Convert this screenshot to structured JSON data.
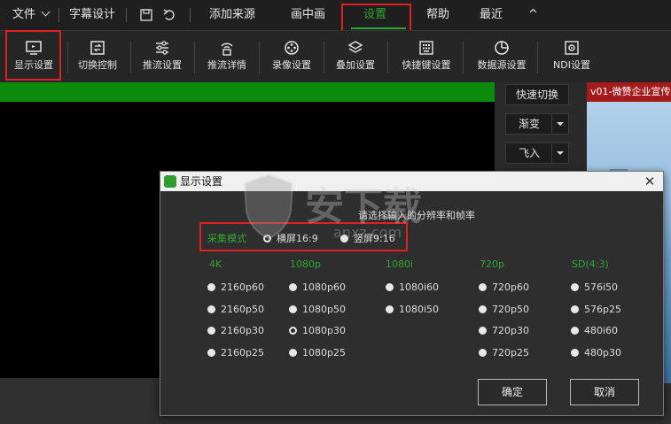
{
  "menubar": {
    "file": "文件",
    "subtitle_design": "字幕设计",
    "add_source": "添加来源",
    "pip": "画中画",
    "settings": "设置",
    "help": "帮助",
    "recent": "最近",
    "collapse_glyph": "^"
  },
  "toolbar": {
    "items": [
      {
        "label": "显示设置",
        "icon": "monitor-icon"
      },
      {
        "label": "切换控制",
        "icon": "switch-icon"
      },
      {
        "label": "推流设置",
        "icon": "sliders-icon"
      },
      {
        "label": "推流详情",
        "icon": "broadcast-icon"
      },
      {
        "label": "录像设置",
        "icon": "record-icon"
      },
      {
        "label": "叠加设置",
        "icon": "layers-icon"
      },
      {
        "label": "快捷键设置",
        "icon": "keyboard-icon"
      },
      {
        "label": "数据源设置",
        "icon": "pie-icon"
      },
      {
        "label": "NDI设置",
        "icon": "ndi-icon"
      }
    ]
  },
  "sidepanel": {
    "quick_switch": "快速切换",
    "transition1": "渐变",
    "transition2": "飞入"
  },
  "rightpane": {
    "title": "v01-微赞企业宣传"
  },
  "dialog": {
    "title": "显示设置",
    "close": "✕",
    "hint": "请选择输入的分辨率和帧率",
    "mode_label": "采集模式",
    "orientation": [
      {
        "label": "横屏16:9",
        "selected": true
      },
      {
        "label": "竖屏9:16",
        "selected": false
      }
    ],
    "columns": [
      {
        "header": "4K",
        "options": [
          {
            "label": "2160p60",
            "selected": false
          },
          {
            "label": "2160p50",
            "selected": false
          },
          {
            "label": "2160p30",
            "selected": false
          },
          {
            "label": "2160p25",
            "selected": false
          }
        ]
      },
      {
        "header": "1080p",
        "options": [
          {
            "label": "1080p60",
            "selected": false
          },
          {
            "label": "1080p50",
            "selected": false
          },
          {
            "label": "1080p30",
            "selected": true
          },
          {
            "label": "1080p25",
            "selected": false
          }
        ]
      },
      {
        "header": "1080i",
        "options": [
          {
            "label": "1080i60",
            "selected": false
          },
          {
            "label": "1080i50",
            "selected": false
          }
        ]
      },
      {
        "header": "720p",
        "options": [
          {
            "label": "720p60",
            "selected": false
          },
          {
            "label": "720p50",
            "selected": false
          },
          {
            "label": "720p30",
            "selected": false
          },
          {
            "label": "720p25",
            "selected": false
          }
        ]
      },
      {
        "header": "SD(4:3)",
        "options": [
          {
            "label": "576i50",
            "selected": false
          },
          {
            "label": "576p25",
            "selected": false
          },
          {
            "label": "480i60",
            "selected": false
          },
          {
            "label": "480p30",
            "selected": false
          }
        ]
      }
    ],
    "ok": "确定",
    "cancel": "取消"
  },
  "watermark": {
    "text": "安下载",
    "sub": "anxz.com"
  },
  "colors": {
    "accent_green": "#2ea62e",
    "highlight_red": "#e02020",
    "program_green": "#0c8a0c"
  }
}
